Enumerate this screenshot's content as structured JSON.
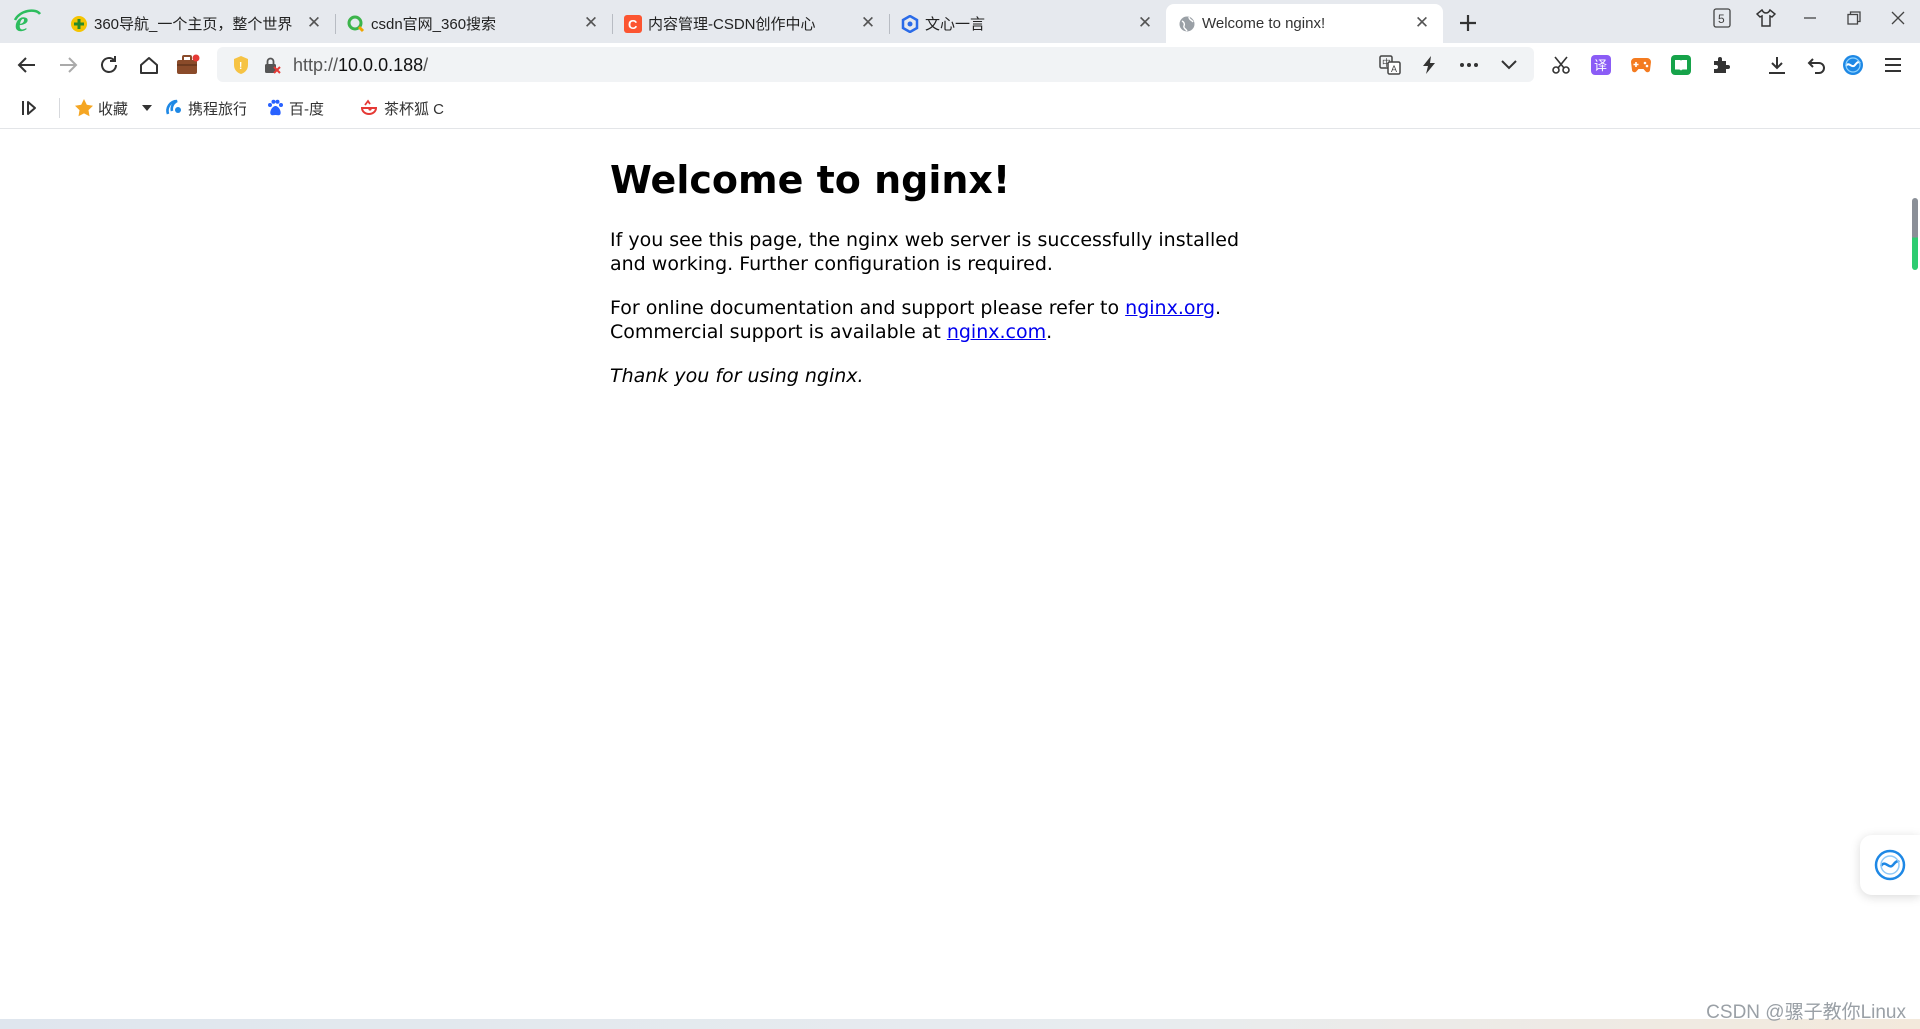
{
  "tabs": [
    {
      "title": "360导航_一个主页，整个世界",
      "favicon": "360-nav-icon",
      "active": false
    },
    {
      "title": "csdn官网_360搜索",
      "favicon": "360-search-icon",
      "active": false
    },
    {
      "title": "内容管理-CSDN创作中心",
      "favicon": "csdn-icon",
      "active": false
    },
    {
      "title": "文心一言",
      "favicon": "wenxin-icon",
      "active": false
    },
    {
      "title": "Welcome to nginx!",
      "favicon": "globe-icon",
      "active": true
    }
  ],
  "tab_counter": "5",
  "address": {
    "scheme": "http://",
    "host": "10.0.0.188",
    "path": "/"
  },
  "bookmarks": {
    "favorites_label": "收藏",
    "items": [
      {
        "label": "携程旅行",
        "icon": "ctrip-icon"
      },
      {
        "label": "百-度",
        "icon": "baidu-paw-icon"
      },
      {
        "label": "茶杯狐 C",
        "icon": "cupfox-icon"
      }
    ]
  },
  "page": {
    "heading": "Welcome to nginx!",
    "para1": "If you see this page, the nginx web server is successfully installed and working. Further configuration is required.",
    "para2_prefix": "For online documentation and support please refer to ",
    "link_org": "nginx.org",
    "para2_mid": ".",
    "para2_line2": "Commercial support is available at ",
    "link_com": "nginx.com",
    "para2_end": ".",
    "thanks": "Thank you for using nginx."
  },
  "watermark": "CSDN @骡子教你Linux",
  "colors": {
    "link": "#0000ee",
    "tabstrip_bg": "#e6e9ee",
    "browser_logo": "#2dbd5e"
  }
}
